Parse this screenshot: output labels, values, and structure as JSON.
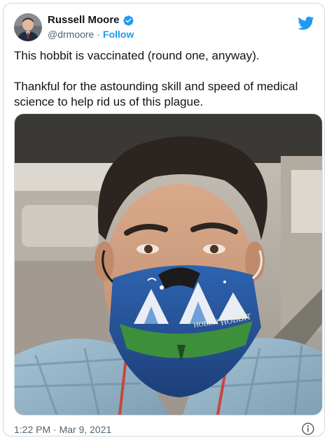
{
  "user": {
    "display_name": "Russell Moore",
    "handle": "@drmoore",
    "separator": "·",
    "follow_label": "Follow",
    "verified": true
  },
  "tweet": {
    "paragraph_1": "This hobbit is vaccinated (round one, anyway).",
    "paragraph_2": "Thankful for the astounding skill and speed of medical science to help rid us of this plague.",
    "timestamp": "1:22 PM · Mar 9, 2021"
  },
  "mask_print": {
    "word_left": "HOBBIT",
    "word_right": "HOBBIT"
  },
  "icons": {
    "verified": "verified-badge-icon",
    "brand": "twitter-bird-icon",
    "info": "info-icon"
  },
  "colors": {
    "accent": "#1d9bf0",
    "text": "#0f1419",
    "muted": "#536471",
    "border": "#cfd9de"
  }
}
